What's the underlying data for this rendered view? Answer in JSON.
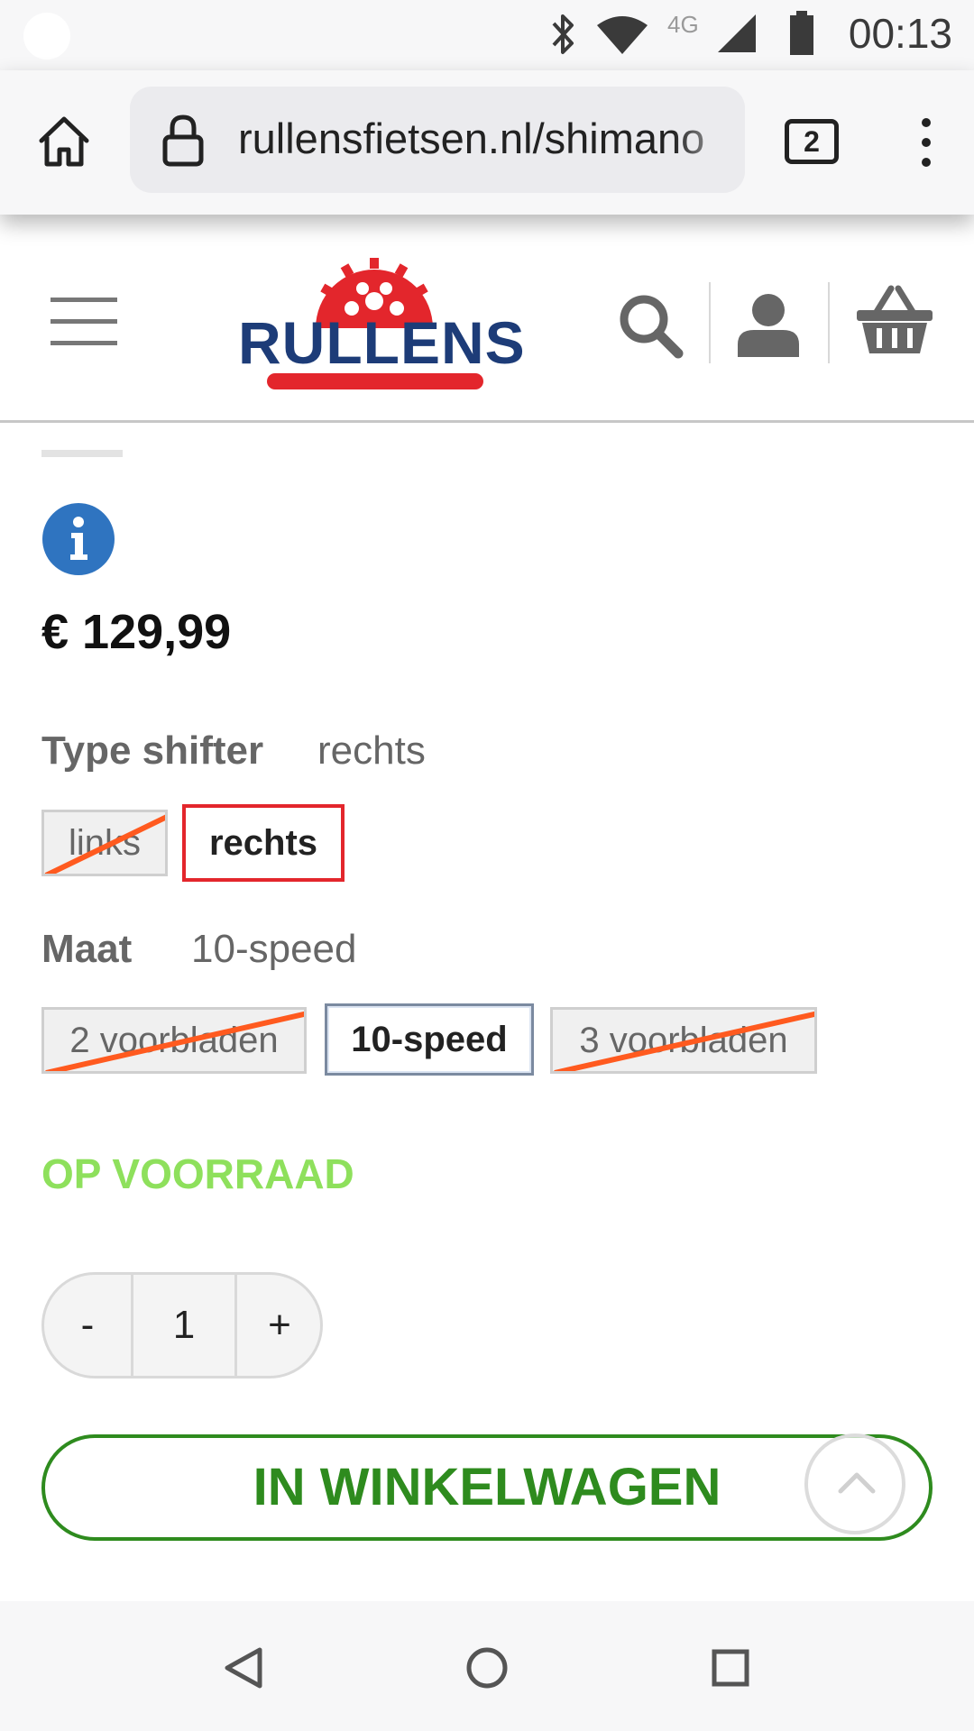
{
  "status_bar": {
    "time": "00:13",
    "network_label": "4G",
    "icons": [
      "notification-dot",
      "bluetooth-icon",
      "wifi-icon",
      "signal-icon",
      "battery-icon"
    ]
  },
  "browser": {
    "url": "rullensfietsen.nl/shimano",
    "tab_count": "2",
    "icons": [
      "home-icon",
      "lock-icon",
      "tab-switcher-icon",
      "more-vert-icon"
    ]
  },
  "header": {
    "logo_text": "RULLENS",
    "icons": [
      "hamburger-menu-icon",
      "search-icon",
      "account-icon",
      "cart-icon"
    ],
    "colors": {
      "logo_blue": "#1d3c78",
      "logo_red": "#e3262c"
    }
  },
  "product": {
    "price": "€ 129,99",
    "info_icon": "info-icon",
    "options": [
      {
        "label": "Type shifter",
        "selected": "rechts",
        "choices": [
          {
            "label": "links",
            "available": false
          },
          {
            "label": "rechts",
            "available": true,
            "selected": true
          }
        ]
      },
      {
        "label": "Maat",
        "selected": "10-speed",
        "choices": [
          {
            "label": "2 voorbladen",
            "available": false
          },
          {
            "label": "10-speed",
            "available": true,
            "selected": true
          },
          {
            "label": "3 voorbladen",
            "available": false
          }
        ]
      }
    ],
    "stock_status": "OP VOORRAAD",
    "quantity": {
      "minus_label": "-",
      "value": "1",
      "plus_label": "+"
    },
    "add_to_cart_label": "IN WINKELWAGEN",
    "colors": {
      "stock_green": "#8ee05c",
      "cart_green": "#2e8b1e",
      "selected_red": "#e3262c",
      "strike_orange": "#ff5a1f",
      "info_blue": "#2f74c0"
    }
  },
  "nav_bar": {
    "icons": [
      "back-icon",
      "home-circle-icon",
      "recents-icon"
    ]
  }
}
